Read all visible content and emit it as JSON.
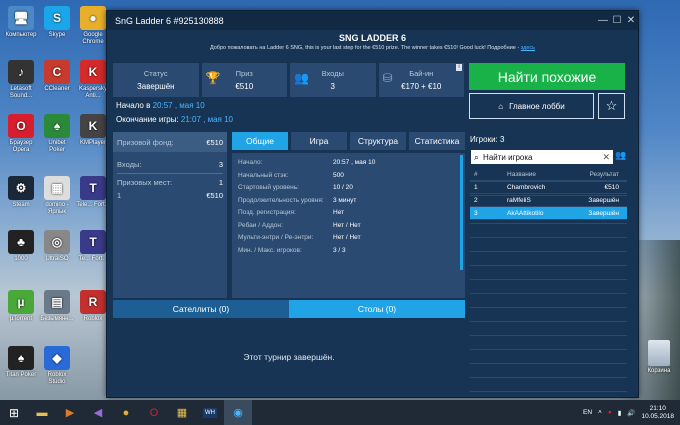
{
  "desktop": {
    "icons": [
      {
        "label": "Компьютер",
        "glyph": "🖥",
        "color": "#4a88c7"
      },
      {
        "label": "Skype",
        "glyph": "S",
        "color": "#1aa6e8"
      },
      {
        "label": "Google Chrome",
        "glyph": "●",
        "color": "#e8b02a"
      },
      {
        "label": "Letasoft Sound...",
        "glyph": "♪",
        "color": "#333"
      },
      {
        "label": "CCleaner",
        "glyph": "C",
        "color": "#c73b2e"
      },
      {
        "label": "Kaspersky Anti...",
        "glyph": "K",
        "color": "#d32a2a"
      },
      {
        "label": "Браузер Opera",
        "glyph": "O",
        "color": "#d81e2c"
      },
      {
        "label": "Unibet Poker",
        "glyph": "♠",
        "color": "#2a8a3a"
      },
      {
        "label": "KMPlayer",
        "glyph": "K",
        "color": "#444"
      },
      {
        "label": "Steam",
        "glyph": "⚙",
        "color": "#1b2838"
      },
      {
        "label": "domino - Ярлык",
        "glyph": "▦",
        "color": "#ddd"
      },
      {
        "label": "Tele... Fort...",
        "glyph": "T",
        "color": "#3a3a8a"
      },
      {
        "label": "1000",
        "glyph": "♣",
        "color": "#222"
      },
      {
        "label": "UltraISO",
        "glyph": "◎",
        "color": "#888"
      },
      {
        "label": "Te... Fort...",
        "glyph": "T",
        "color": "#3a3a8a"
      },
      {
        "label": "µTorrent",
        "glyph": "µ",
        "color": "#4aa83a"
      },
      {
        "label": "Безымянн...",
        "glyph": "▤",
        "color": "#6a7a8a"
      },
      {
        "label": "Roblox",
        "glyph": "R",
        "color": "#c23030"
      },
      {
        "label": "Titan Poker",
        "glyph": "♠",
        "color": "#222"
      },
      {
        "label": "Roblox Studio",
        "glyph": "◆",
        "color": "#2a6ad8"
      }
    ],
    "recycle": "Корзина"
  },
  "window": {
    "title": "SnG Ladder 6 #925130888",
    "controls": [
      "—",
      "☐",
      "✕"
    ]
  },
  "header": {
    "title": "SNG LADDER 6",
    "subtitle": "Добро пожаловать на Ladder 6 SNG, this is your last step for the €510 prize. The winner takes €510! Good luck! Подробние - ",
    "link": "здесь"
  },
  "stats": [
    {
      "label": "Статус",
      "value": "Завершён",
      "icon": ""
    },
    {
      "label": "Приз",
      "value": "€510",
      "icon": "trophy-icon"
    },
    {
      "label": "Входы",
      "value": "3",
      "icon": "players-icon"
    },
    {
      "label": "Бай-ин",
      "value": "€170 + €10",
      "icon": "chips-icon"
    }
  ],
  "times": {
    "start_label": "Начало в",
    "start_value": "20:57 , мая 10",
    "end_label": "Окончание игры:",
    "end_value": "21:07 , мая 10"
  },
  "actions": {
    "find_similar": "Найти похожие",
    "main_lobby": "Главное лобби"
  },
  "leftpanel": {
    "prize_label": "Призовой фонд:",
    "prize_value": "€510",
    "entries_label": "Входы:",
    "entries_value": "3",
    "paid_label": "Призовых мест:",
    "paid_value": "1",
    "payouts": [
      {
        "place": "1",
        "amount": "€510"
      }
    ]
  },
  "tabs": [
    "Общие",
    "Игра",
    "Структура",
    "Статистика"
  ],
  "details": [
    {
      "k": "Начало:",
      "v": "20:57 , мая 10"
    },
    {
      "k": "Начальный стэк:",
      "v": "500"
    },
    {
      "k": "Стартовый уровень:",
      "v": "10 / 20"
    },
    {
      "k": "Продолжительность уровня:",
      "v": "3 минут"
    },
    {
      "k": "Позд. регистрация:",
      "v": "Нет"
    },
    {
      "k": "Ребаи / Аддон:",
      "v": "Нет / Нет"
    },
    {
      "k": "Мульти-энтри / Ре-энтри:",
      "v": "Нет / Нет"
    },
    {
      "k": "Мин. / Макс. игроков:",
      "v": "3 / 3"
    }
  ],
  "bottom": {
    "tabs": [
      "Сателлиты (0)",
      "Столы (0)"
    ],
    "message": "Этот турнир завершён."
  },
  "players": {
    "header": "Игроки: 3",
    "search_placeholder": "Найти игрока",
    "columns": [
      "#",
      "Название",
      "Результат"
    ],
    "rows": [
      {
        "n": "1",
        "name": "Chambrovich",
        "result": "€510"
      },
      {
        "n": "2",
        "name": "raMfeliS",
        "result": "Завершён"
      },
      {
        "n": "3",
        "name": "AkAAttikotilo",
        "result": "Завершён"
      }
    ]
  },
  "taskbar": {
    "lang": "EN",
    "time": "21:10",
    "date": "10.05.2018"
  },
  "colors": {
    "accent": "#20a4e6",
    "green": "#19b248",
    "panel": "#2a4a71",
    "bg": "#173454"
  }
}
